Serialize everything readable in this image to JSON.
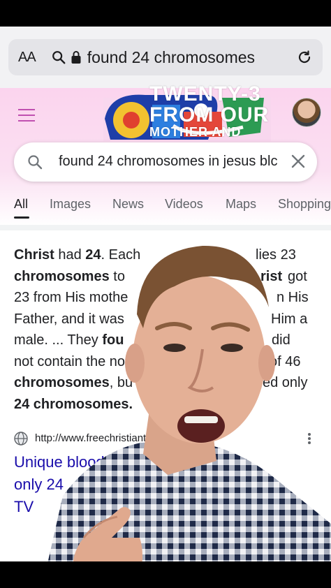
{
  "browser": {
    "aa_label": "AA",
    "url_text": "found 24 chromosomes"
  },
  "header": {
    "doodle_lines": [
      "TWENTY-3",
      "FROM OUR",
      "MOTHER AND"
    ]
  },
  "search": {
    "query": "found 24 chromosomes in jesus blc"
  },
  "tabs": [
    {
      "label": "All"
    },
    {
      "label": "Images"
    },
    {
      "label": "News"
    },
    {
      "label": "Videos"
    },
    {
      "label": "Maps"
    },
    {
      "label": "Shopping"
    }
  ],
  "snippet": {
    "line1": [
      "Christ",
      " had ",
      "24",
      ". Each",
      "lies 23"
    ],
    "line2": [
      "chromosomes",
      " to",
      "rist",
      " got"
    ],
    "line3": "23 from His mothe",
    "line3b": "n His",
    "line4a": "Father, and it was",
    "line4b": "Him a",
    "line5a": "male. ... They ",
    "line5b": "fou",
    "line5c": "did",
    "line6a": "not contain the no",
    "line6b": "of 46",
    "line7a": "chromosomes",
    "line7b": ", bu",
    "line7c": "ed only",
    "line8": "24 chromosomes."
  },
  "result": {
    "url": "http://www.freechristiante",
    "title_lines": [
      "Unique blood of",
      "only 24",
      "TV"
    ]
  },
  "colors": {
    "link": "#1a0dab",
    "header_pink": "#fbd4ee"
  }
}
